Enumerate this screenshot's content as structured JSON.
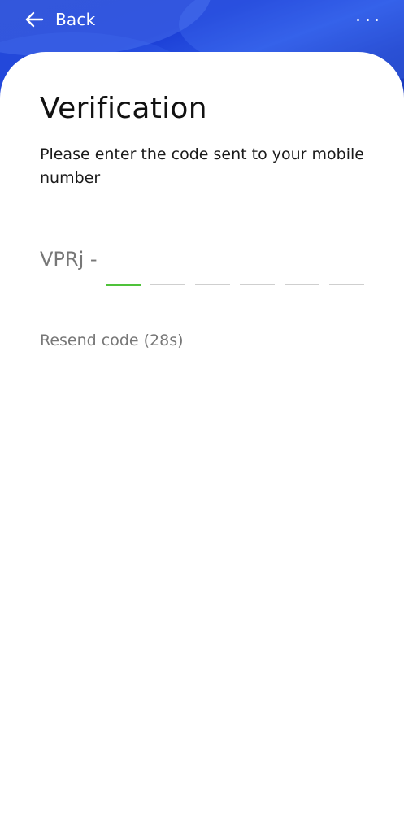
{
  "header": {
    "back_label": "Back",
    "back_icon": "arrow-left-icon",
    "more_icon": "more-horizontal-icon",
    "gradient_color": "#1b3ed6"
  },
  "main": {
    "title": "Verification",
    "subtitle": "Please enter the code sent to your mobile number",
    "code_prefix": "VPRj -",
    "digits": [
      "",
      "",
      "",
      "",
      "",
      ""
    ],
    "active_color": "#4fc23a",
    "resend_label": "Resend code (28s)"
  }
}
